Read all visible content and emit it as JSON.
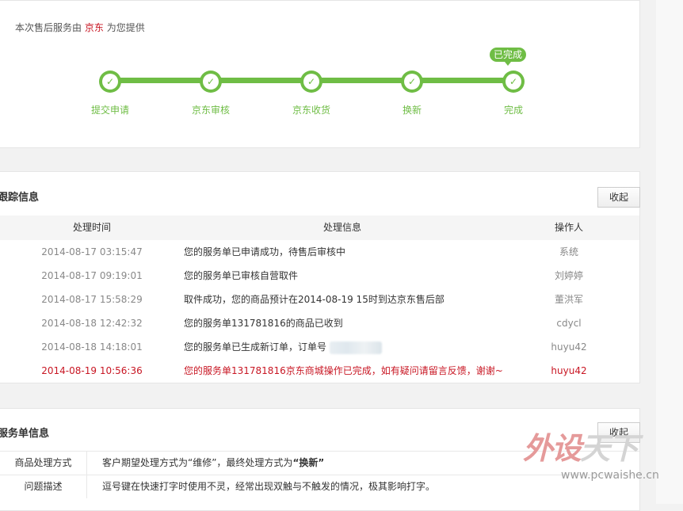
{
  "progress": {
    "provider_prefix": "本次售后服务由",
    "provider_name": "京东",
    "provider_suffix": "为您提供",
    "badge": "已完成",
    "steps": [
      {
        "label": "提交申请"
      },
      {
        "label": "京东审核"
      },
      {
        "label": "京东收货"
      },
      {
        "label": "换新"
      },
      {
        "label": "完成"
      }
    ]
  },
  "tracking": {
    "title": "跟踪信息",
    "collapse_label": "收起",
    "headers": {
      "time": "处理时间",
      "info": "处理信息",
      "operator": "操作人"
    },
    "rows": [
      {
        "time": "2014-08-17 03:15:47",
        "info": "您的服务单已申请成功，待售后审核中",
        "operator": "系统"
      },
      {
        "time": "2014-08-17 09:19:01",
        "info": "您的服务单已审核自营取件",
        "operator": "刘婷婷"
      },
      {
        "time": "2014-08-17 15:58:29",
        "info": "取件成功，您的商品预计在2014-08-19 15时到达京东售后部",
        "operator": "董洪军"
      },
      {
        "time": "2014-08-18 12:42:32",
        "info": "您的服务单131781816的商品已收到",
        "operator": "cdycl"
      },
      {
        "time": "2014-08-18 14:18:01",
        "info": "您的服务单已生成新订单，订单号",
        "operator": "huyu42"
      },
      {
        "time": "2014-08-19 10:56:36",
        "info": "您的服务单131781816京东商城操作已完成，如有疑问请留言反馈，谢谢~",
        "operator": "huyu42"
      }
    ]
  },
  "service": {
    "title": "服务单信息",
    "collapse_label": "收起",
    "rows": [
      {
        "key": "商品处理方式",
        "value_prefix": "客户期望处理方式为“维修”，最终处理方式为",
        "value_bold": "“换新”"
      },
      {
        "key": "问题描述",
        "value_prefix": "逗号键在快速打字时使用不灵，经常出现双触与不触发的情况，极其影响打字。",
        "value_bold": ""
      }
    ]
  },
  "watermark": {
    "text_part1": "外设",
    "text_part2": "天下",
    "url": "www.pcwaishe.cn"
  },
  "colors": {
    "accent_green": "#6fbd45",
    "jd_red": "#c81623"
  }
}
